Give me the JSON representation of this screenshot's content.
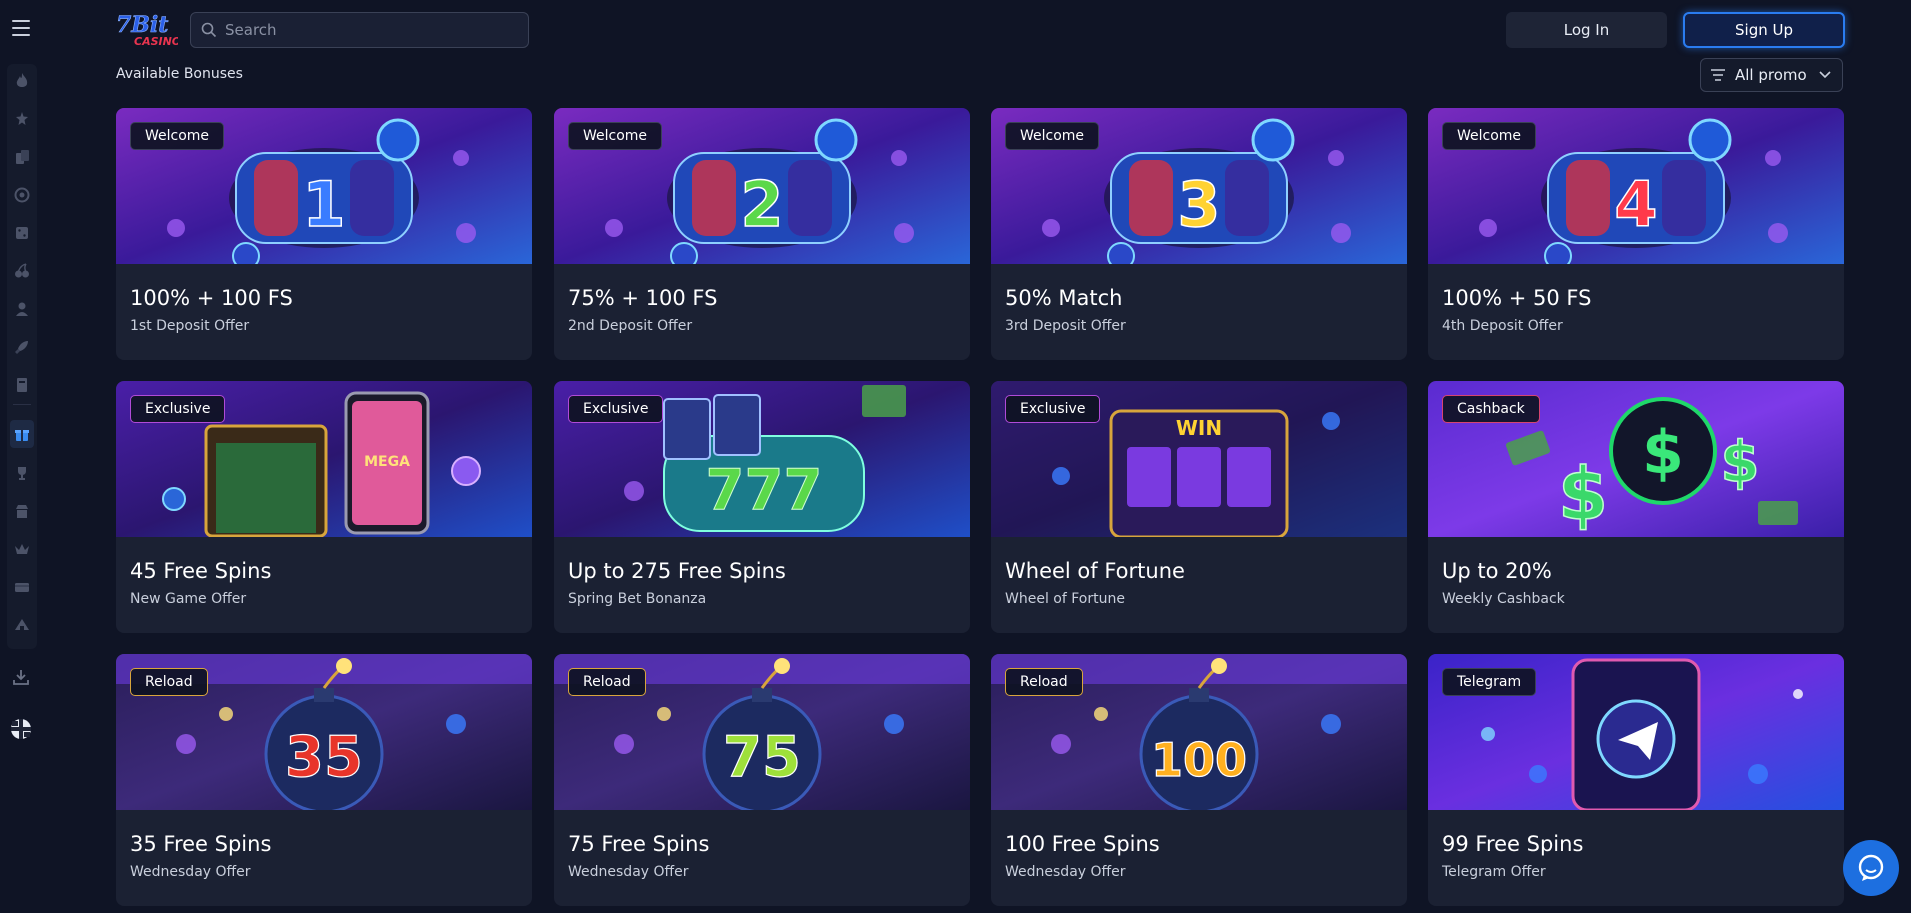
{
  "header": {
    "logo_text": "7Bit CASINO",
    "search_placeholder": "Search",
    "login_label": "Log In",
    "signup_label": "Sign Up"
  },
  "sidebar": {
    "icons": [
      "fire-icon",
      "joystick-icon",
      "cards-icon",
      "target-icon",
      "dice-icon",
      "cherry-icon",
      "dealer-icon",
      "rocket-icon",
      "book-icon",
      "gift-icon",
      "trophy-icon",
      "shop-icon",
      "crown-icon",
      "ticket-icon",
      "tent-icon"
    ],
    "active": "gift-icon"
  },
  "main": {
    "section_title": "Available Bonuses",
    "filter_label": "All promo",
    "cards": [
      {
        "tag": "Welcome",
        "tag_type": "welcome",
        "title": "100% + 100 FS",
        "subtitle": "1st Deposit Offer",
        "art": "1"
      },
      {
        "tag": "Welcome",
        "tag_type": "welcome",
        "title": "75% + 100 FS",
        "subtitle": "2nd Deposit Offer",
        "art": "2"
      },
      {
        "tag": "Welcome",
        "tag_type": "welcome",
        "title": "50% Match",
        "subtitle": "3rd Deposit Offer",
        "art": "3"
      },
      {
        "tag": "Welcome",
        "tag_type": "welcome",
        "title": "100% + 50 FS",
        "subtitle": "4th Deposit Offer",
        "art": "4"
      },
      {
        "tag": "Exclusive",
        "tag_type": "exclusive",
        "title": "45 Free Spins",
        "subtitle": "New Game Offer",
        "art": "MEGA"
      },
      {
        "tag": "Exclusive",
        "tag_type": "exclusive",
        "title": "Up to 275 Free Spins",
        "subtitle": "Spring Bet Bonanza",
        "art": "777"
      },
      {
        "tag": "Exclusive",
        "tag_type": "exclusive",
        "title": "Wheel of Fortune",
        "subtitle": "Wheel of Fortune",
        "art": "WIN"
      },
      {
        "tag": "Cashback",
        "tag_type": "cashback",
        "title": "Up to 20%",
        "subtitle": "Weekly Cashback",
        "art": "$"
      },
      {
        "tag": "Reload",
        "tag_type": "reload",
        "title": "35 Free Spins",
        "subtitle": "Wednesday Offer",
        "art": "35"
      },
      {
        "tag": "Reload",
        "tag_type": "reload",
        "title": "75 Free Spins",
        "subtitle": "Wednesday Offer",
        "art": "75"
      },
      {
        "tag": "Reload",
        "tag_type": "reload",
        "title": "100 Free Spins",
        "subtitle": "Wednesday Offer",
        "art": "100"
      },
      {
        "tag": "Telegram",
        "tag_type": "telegram",
        "title": "99 Free Spins",
        "subtitle": "Telegram Offer",
        "art": ""
      }
    ]
  },
  "colors": {
    "background": "#0f1425",
    "card": "#1b2133",
    "accent_blue": "#2a7cf0",
    "welcome_bg": "#6a2bbf",
    "reload_bg": "#2a1e5a"
  }
}
